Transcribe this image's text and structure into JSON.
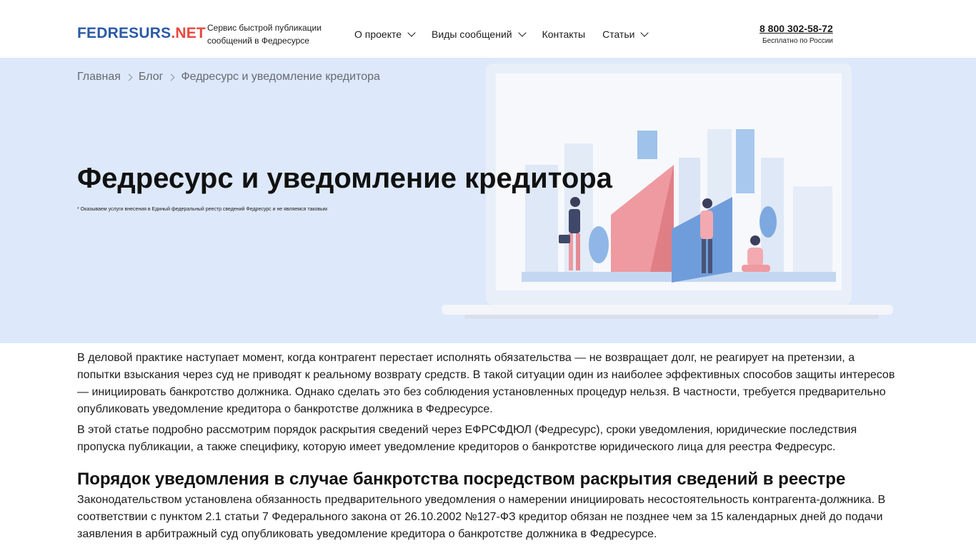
{
  "header": {
    "logo": {
      "part1": "FEDRESURS",
      "part2": ".NET"
    },
    "tagline_line1": "Сервис быстрой публикации",
    "tagline_line2": "сообщений в Федресурсе",
    "nav": [
      {
        "label": "О проекте",
        "has_dropdown": true
      },
      {
        "label": "Виды сообщений",
        "has_dropdown": true
      },
      {
        "label": "Контакты",
        "has_dropdown": false
      },
      {
        "label": "Статьи",
        "has_dropdown": true
      }
    ],
    "phone": "8 800 302-58-72",
    "phone_note": "Бесплатно по России"
  },
  "hero": {
    "breadcrumb": [
      "Главная",
      "Блог",
      "Федресурс и уведомление кредитора"
    ],
    "title": "Федресурс и уведомление кредитора",
    "note": "* Оказываем услуги внесения в Единый федеральный реестр сведений Федресурс и не являемся таковым"
  },
  "article": {
    "paragraph1": "В деловой практике наступает момент, когда контрагент перестает исполнять обязательства — не возвращает долг, не реагирует на претензии, а попытки взыскания через суд не приводят к реальному возврату средств. В такой ситуации один из наиболее эффективных способов защиты интересов — инициировать банкротство должника. Однако сделать это без соблюдения установленных процедур нельзя. В частности, требуется предварительно опубликовать уведомление кредитора о банкротстве должника в Федресурсе.",
    "paragraph2": "В этой статье подробно рассмотрим порядок раскрытия сведений через ЕФРСФДЮЛ (Федресурс), сроки уведомления, юридические последствия пропуска публикации, а также специфику, которую имеет уведомление кредиторов о банкротстве юридического лица для реестра Федресурс.",
    "heading1": "Порядок уведомления в случае банкротства посредством раскрытия сведений в реестре",
    "paragraph3": "Законодательством установлена обязанность предварительного уведомления о намерении инициировать несостоятельность контрагента-должника. В соответствии с пунктом 2.1 статьи 7 Федерального закона от 26.10.2002 №127-ФЗ кредитор обязан не позднее чем за 15 календарных дней до подачи заявления в арбитражный суд опубликовать уведомление кредитора о банкротстве должника в Федресурсе."
  },
  "colors": {
    "brand_blue": "#2b5aa6",
    "brand_red": "#e8473f",
    "hero_bg": "#dde8fb"
  }
}
